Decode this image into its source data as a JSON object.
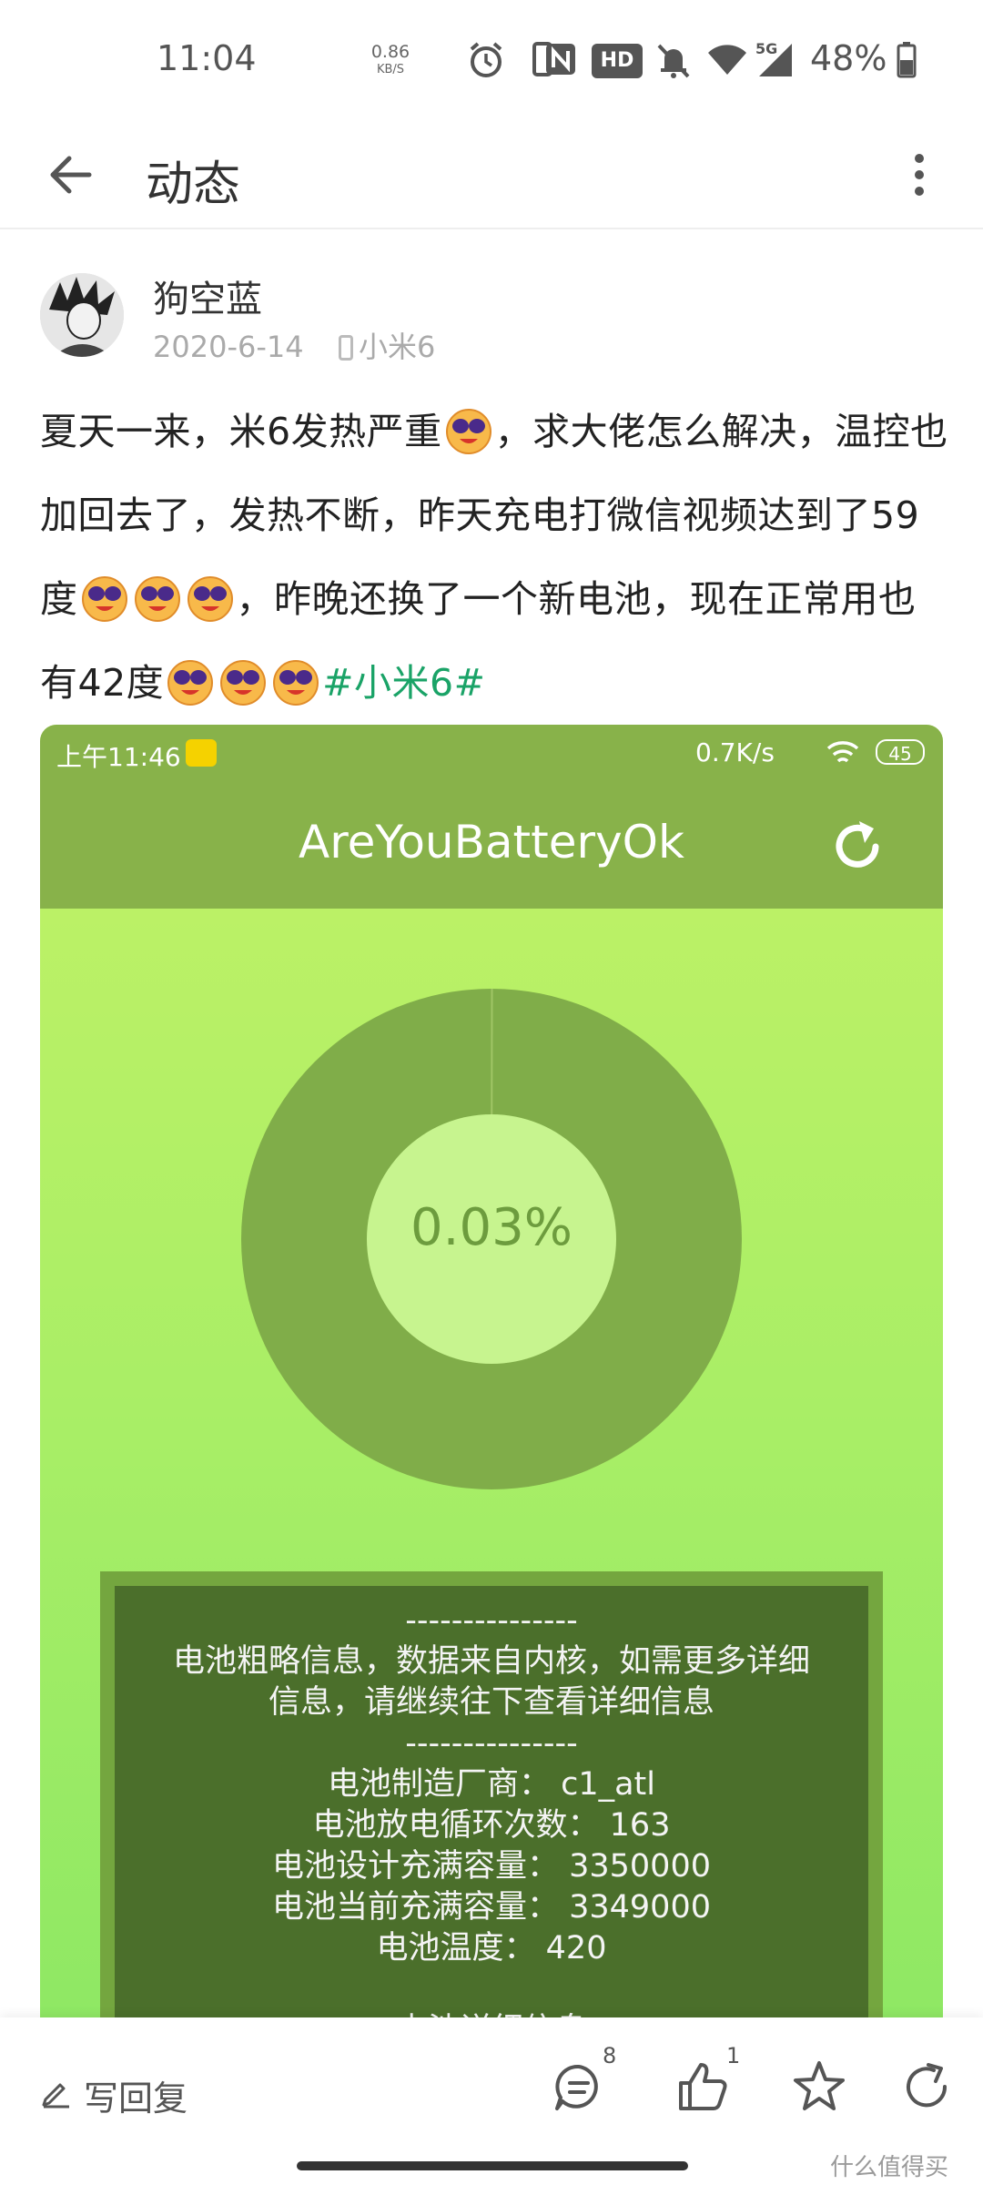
{
  "status_bar": {
    "time": "11:04",
    "net_speed": "0.86",
    "net_unit": "KB/S",
    "hd_label": "HD",
    "signal_label": "5G",
    "battery": "48%"
  },
  "app_bar": {
    "title": "动态"
  },
  "post": {
    "author": "狗空蓝",
    "date": "2020-6-14",
    "device": "小米6",
    "text_parts": [
      "夏天一来，米6发热严重",
      "，求大佬怎么解决，温控也加回去了，发热不断，昨天充电打微信视频达到了59度",
      "，昨晚还换了一个新电池，现在正常用也有42度"
    ],
    "hashtag": "#小米6#"
  },
  "embedded_screenshot": {
    "status_time": "上午11:46",
    "status_speed": "0.7K/s",
    "status_battery": "45",
    "app_title": "AreYouBatteryOk",
    "percent_label": "0.03%",
    "percent_value": 0.03,
    "info_lines": [
      "---------------",
      "电池粗略信息，数据来自内核，如需更多详细",
      "信息，请继续往下查看详细信息",
      "---------------",
      "电池制造厂商：  c1_atl",
      "电池放电循环次数：  163",
      "电池设计充满容量：  3350000",
      "电池当前充满容量：  3349000",
      "电池温度：  420",
      "",
      "电池详细信息"
    ]
  },
  "bottom_bar": {
    "reply_label": "写回复",
    "comment_count": "8",
    "like_count": "1"
  },
  "watermark": "什么值得买",
  "colors": {
    "hashtag": "#1aa367",
    "screenshot_bar": "#88b24a",
    "screenshot_bg_top": "#c2f266",
    "donut": "#80ad49",
    "info_bg": "#4b6f2b"
  }
}
